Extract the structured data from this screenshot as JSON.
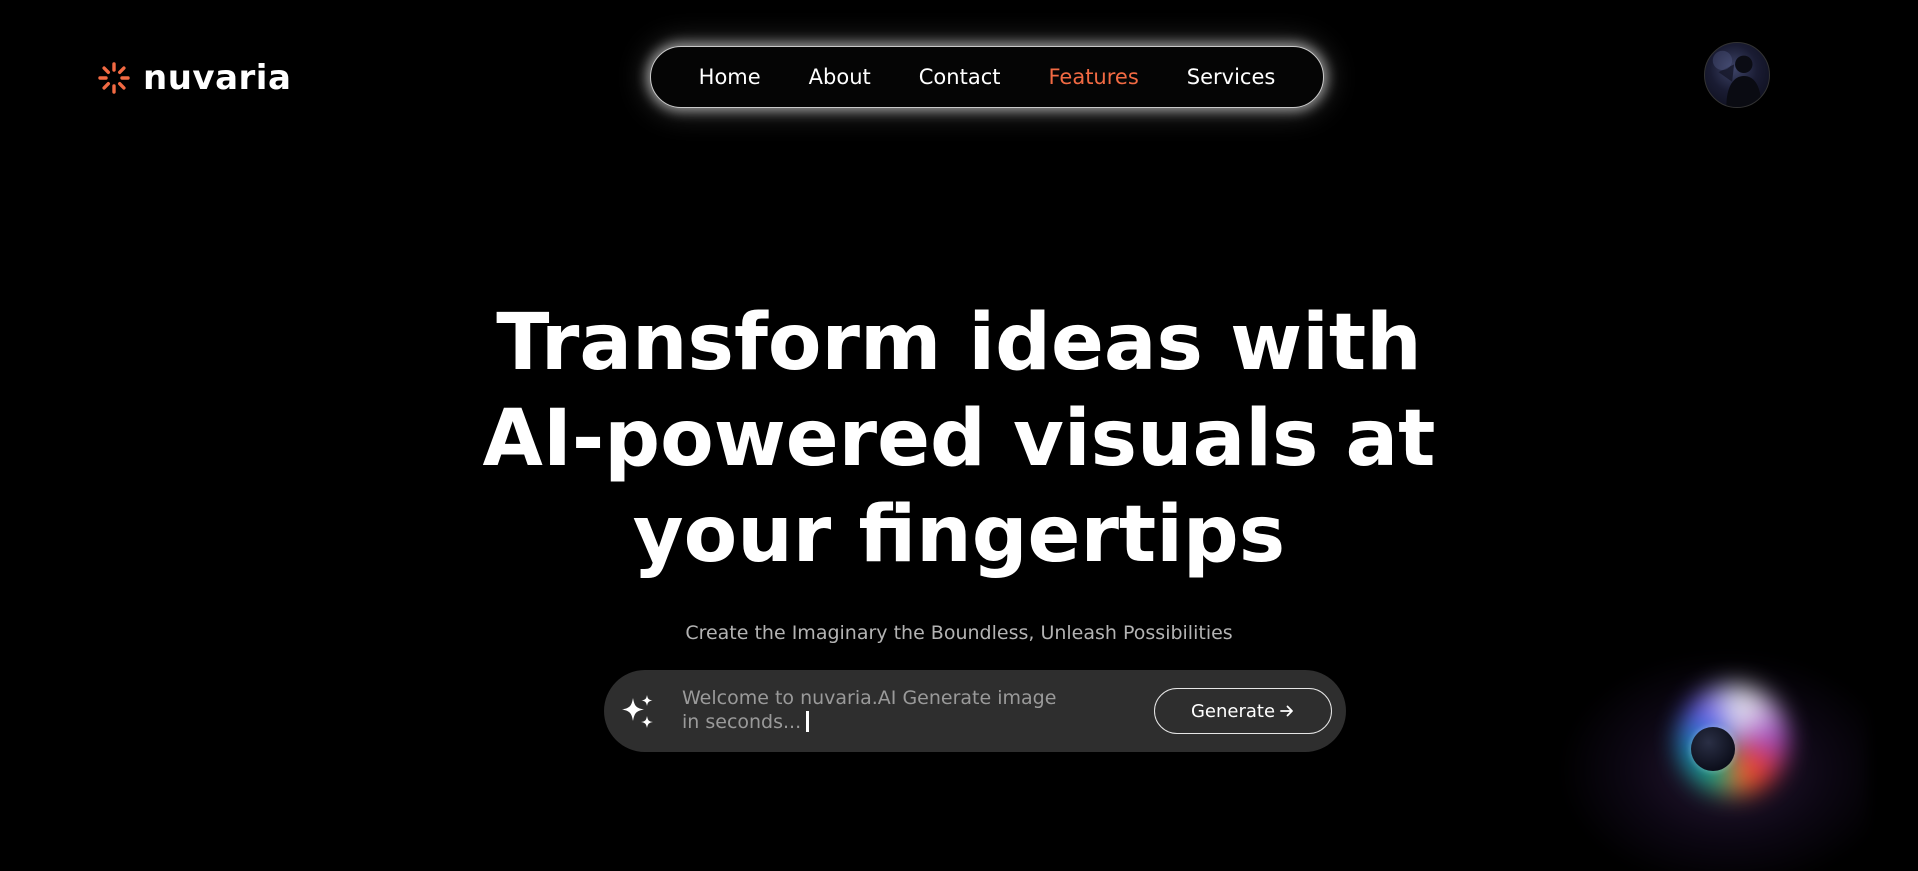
{
  "brand": {
    "name": "nuvaria",
    "logo_icon": "sunburst-icon",
    "logo_color": "#f26a43"
  },
  "nav": {
    "items": [
      {
        "label": "Home",
        "active": false
      },
      {
        "label": "About",
        "active": false
      },
      {
        "label": "Contact",
        "active": false
      },
      {
        "label": "Features",
        "active": true
      },
      {
        "label": "Services",
        "active": false
      }
    ],
    "active_color": "#f26a43"
  },
  "user": {
    "avatar_icon": "user-avatar"
  },
  "hero": {
    "title": "Transform ideas with AI-powered visuals at your fingertips",
    "subtitle": "Create the Imaginary the Boundless, Unleash Possibilities"
  },
  "prompt": {
    "icon": "sparkle-icon",
    "text": "Welcome to nuvaria.AI Generate image in seconds...",
    "button_label": "Generate",
    "button_icon": "arrow-right-icon"
  },
  "colors": {
    "background": "#000000",
    "prompt_bar": "#2e2e2e",
    "accent": "#f26a43"
  }
}
